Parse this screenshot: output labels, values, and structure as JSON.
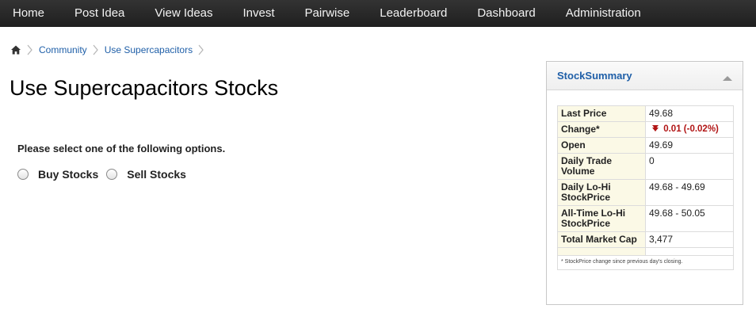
{
  "nav": {
    "items": [
      {
        "label": "Home"
      },
      {
        "label": "Post Idea"
      },
      {
        "label": "View Ideas"
      },
      {
        "label": "Invest"
      },
      {
        "label": "Pairwise"
      },
      {
        "label": "Leaderboard"
      },
      {
        "label": "Dashboard"
      },
      {
        "label": "Administration"
      }
    ]
  },
  "breadcrumb": {
    "icon": "home-icon",
    "items": [
      {
        "label": "Community"
      },
      {
        "label": "Use Supercapacitors"
      }
    ]
  },
  "page": {
    "title": "Use Supercapacitors Stocks"
  },
  "options": {
    "prompt": "Please select one of the following options.",
    "choices": [
      {
        "label": "Buy Stocks",
        "selected": false
      },
      {
        "label": "Sell Stocks",
        "selected": false
      }
    ]
  },
  "stock_summary": {
    "title": "StockSummary",
    "collapse_icon": "collapse-up-icon",
    "rows": [
      {
        "label": "Last Price",
        "value": "49.68"
      },
      {
        "label": "Change*",
        "value": "0.01 (-0.02%)",
        "trend": "down",
        "color": "#b11414"
      },
      {
        "label": "Open",
        "value": "49.69"
      },
      {
        "label": "Daily Trade Volume",
        "value": "0"
      },
      {
        "label": "Daily Lo-Hi StockPrice",
        "value": "49.68 - 49.69"
      },
      {
        "label": "All-Time Lo-Hi StockPrice",
        "value": "49.68 - 50.05"
      },
      {
        "label": "Total Market Cap",
        "value": "3,477"
      }
    ],
    "footnote": "* StockPrice change since previous day's closing."
  },
  "colors": {
    "nav_bg": "#262626",
    "link": "#1f5fa8",
    "negative": "#b11414",
    "label_bg": "#fbf9e6"
  }
}
